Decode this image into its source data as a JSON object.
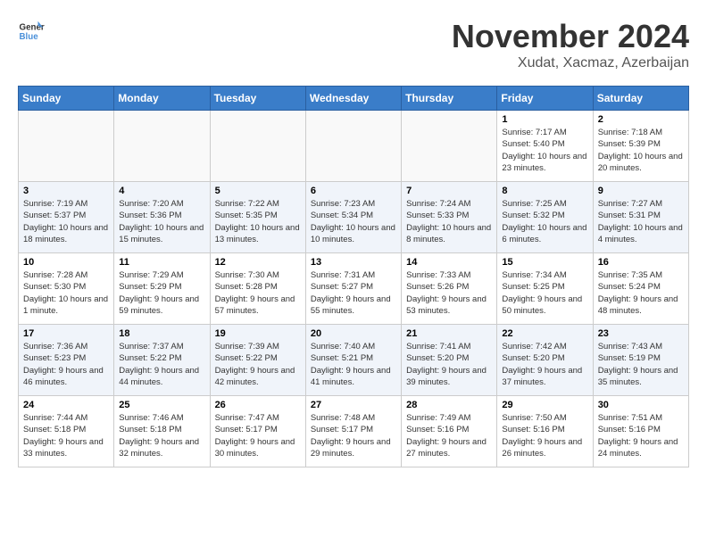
{
  "header": {
    "logo_line1": "General",
    "logo_line2": "Blue",
    "month": "November 2024",
    "location": "Xudat, Xacmaz, Azerbaijan"
  },
  "weekdays": [
    "Sunday",
    "Monday",
    "Tuesday",
    "Wednesday",
    "Thursday",
    "Friday",
    "Saturday"
  ],
  "weeks": [
    [
      {
        "day": "",
        "info": ""
      },
      {
        "day": "",
        "info": ""
      },
      {
        "day": "",
        "info": ""
      },
      {
        "day": "",
        "info": ""
      },
      {
        "day": "",
        "info": ""
      },
      {
        "day": "1",
        "info": "Sunrise: 7:17 AM\nSunset: 5:40 PM\nDaylight: 10 hours and 23 minutes."
      },
      {
        "day": "2",
        "info": "Sunrise: 7:18 AM\nSunset: 5:39 PM\nDaylight: 10 hours and 20 minutes."
      }
    ],
    [
      {
        "day": "3",
        "info": "Sunrise: 7:19 AM\nSunset: 5:37 PM\nDaylight: 10 hours and 18 minutes."
      },
      {
        "day": "4",
        "info": "Sunrise: 7:20 AM\nSunset: 5:36 PM\nDaylight: 10 hours and 15 minutes."
      },
      {
        "day": "5",
        "info": "Sunrise: 7:22 AM\nSunset: 5:35 PM\nDaylight: 10 hours and 13 minutes."
      },
      {
        "day": "6",
        "info": "Sunrise: 7:23 AM\nSunset: 5:34 PM\nDaylight: 10 hours and 10 minutes."
      },
      {
        "day": "7",
        "info": "Sunrise: 7:24 AM\nSunset: 5:33 PM\nDaylight: 10 hours and 8 minutes."
      },
      {
        "day": "8",
        "info": "Sunrise: 7:25 AM\nSunset: 5:32 PM\nDaylight: 10 hours and 6 minutes."
      },
      {
        "day": "9",
        "info": "Sunrise: 7:27 AM\nSunset: 5:31 PM\nDaylight: 10 hours and 4 minutes."
      }
    ],
    [
      {
        "day": "10",
        "info": "Sunrise: 7:28 AM\nSunset: 5:30 PM\nDaylight: 10 hours and 1 minute."
      },
      {
        "day": "11",
        "info": "Sunrise: 7:29 AM\nSunset: 5:29 PM\nDaylight: 9 hours and 59 minutes."
      },
      {
        "day": "12",
        "info": "Sunrise: 7:30 AM\nSunset: 5:28 PM\nDaylight: 9 hours and 57 minutes."
      },
      {
        "day": "13",
        "info": "Sunrise: 7:31 AM\nSunset: 5:27 PM\nDaylight: 9 hours and 55 minutes."
      },
      {
        "day": "14",
        "info": "Sunrise: 7:33 AM\nSunset: 5:26 PM\nDaylight: 9 hours and 53 minutes."
      },
      {
        "day": "15",
        "info": "Sunrise: 7:34 AM\nSunset: 5:25 PM\nDaylight: 9 hours and 50 minutes."
      },
      {
        "day": "16",
        "info": "Sunrise: 7:35 AM\nSunset: 5:24 PM\nDaylight: 9 hours and 48 minutes."
      }
    ],
    [
      {
        "day": "17",
        "info": "Sunrise: 7:36 AM\nSunset: 5:23 PM\nDaylight: 9 hours and 46 minutes."
      },
      {
        "day": "18",
        "info": "Sunrise: 7:37 AM\nSunset: 5:22 PM\nDaylight: 9 hours and 44 minutes."
      },
      {
        "day": "19",
        "info": "Sunrise: 7:39 AM\nSunset: 5:22 PM\nDaylight: 9 hours and 42 minutes."
      },
      {
        "day": "20",
        "info": "Sunrise: 7:40 AM\nSunset: 5:21 PM\nDaylight: 9 hours and 41 minutes."
      },
      {
        "day": "21",
        "info": "Sunrise: 7:41 AM\nSunset: 5:20 PM\nDaylight: 9 hours and 39 minutes."
      },
      {
        "day": "22",
        "info": "Sunrise: 7:42 AM\nSunset: 5:20 PM\nDaylight: 9 hours and 37 minutes."
      },
      {
        "day": "23",
        "info": "Sunrise: 7:43 AM\nSunset: 5:19 PM\nDaylight: 9 hours and 35 minutes."
      }
    ],
    [
      {
        "day": "24",
        "info": "Sunrise: 7:44 AM\nSunset: 5:18 PM\nDaylight: 9 hours and 33 minutes."
      },
      {
        "day": "25",
        "info": "Sunrise: 7:46 AM\nSunset: 5:18 PM\nDaylight: 9 hours and 32 minutes."
      },
      {
        "day": "26",
        "info": "Sunrise: 7:47 AM\nSunset: 5:17 PM\nDaylight: 9 hours and 30 minutes."
      },
      {
        "day": "27",
        "info": "Sunrise: 7:48 AM\nSunset: 5:17 PM\nDaylight: 9 hours and 29 minutes."
      },
      {
        "day": "28",
        "info": "Sunrise: 7:49 AM\nSunset: 5:16 PM\nDaylight: 9 hours and 27 minutes."
      },
      {
        "day": "29",
        "info": "Sunrise: 7:50 AM\nSunset: 5:16 PM\nDaylight: 9 hours and 26 minutes."
      },
      {
        "day": "30",
        "info": "Sunrise: 7:51 AM\nSunset: 5:16 PM\nDaylight: 9 hours and 24 minutes."
      }
    ]
  ]
}
